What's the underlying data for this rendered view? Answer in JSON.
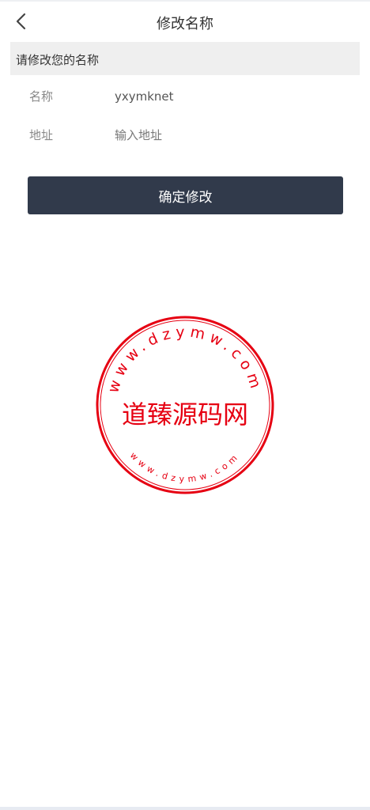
{
  "header": {
    "title": "修改名称",
    "back_icon": "chevron-left-icon"
  },
  "section": {
    "label": "请修改您的名称"
  },
  "form": {
    "name_label": "名称",
    "name_value": "yxymknet",
    "address_label": "地址",
    "address_placeholder": "输入地址",
    "address_value": ""
  },
  "confirm": {
    "label": "确定修改"
  },
  "watermark": {
    "site_name": "道臻源码网",
    "url_top": "www.dzymw.com",
    "url_bottom": "www.dzymw.com",
    "color": "#e60012"
  },
  "theme": {
    "button_color": "#313a4b",
    "section_bg": "#efefef"
  }
}
